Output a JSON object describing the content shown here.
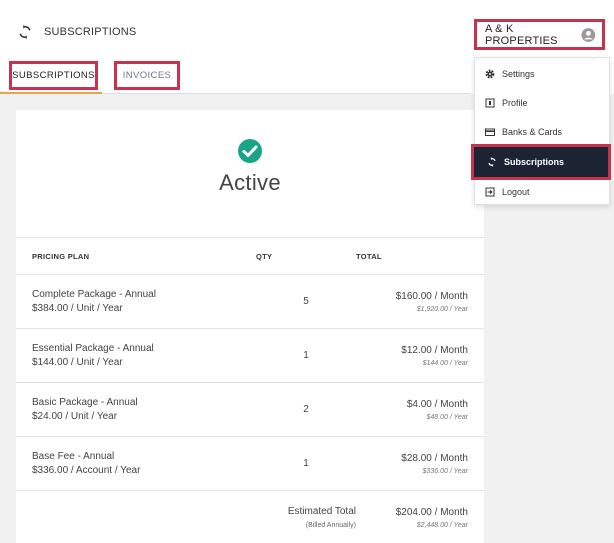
{
  "header": {
    "title": "SUBSCRIPTIONS",
    "account_name": "A & K PROPERTIES"
  },
  "tabs": [
    {
      "label": "SUBSCRIPTIONS",
      "active": true
    },
    {
      "label": "INVOICES",
      "active": false
    }
  ],
  "status": {
    "text": "Active",
    "color": "#1aa386"
  },
  "table": {
    "headers": {
      "plan": "PRICING PLAN",
      "qty": "QTY",
      "total": "TOTAL"
    },
    "rows": [
      {
        "name": "Complete Package - Annual",
        "unit_price": "$384.00 / Unit / Year",
        "qty": "5",
        "monthly": "$160.00 / Month",
        "yearly": "$1,920.00 / Year"
      },
      {
        "name": "Essential Package - Annual",
        "unit_price": "$144.00 / Unit / Year",
        "qty": "1",
        "monthly": "$12.00 / Month",
        "yearly": "$144.00 / Year"
      },
      {
        "name": "Basic Package - Annual",
        "unit_price": "$24.00 / Unit / Year",
        "qty": "2",
        "monthly": "$4.00 / Month",
        "yearly": "$48.00 / Year"
      },
      {
        "name": "Base Fee - Annual",
        "unit_price": "$336.00 / Account / Year",
        "qty": "1",
        "monthly": "$28.00 / Month",
        "yearly": "$336.00 / Year"
      }
    ],
    "estimate": {
      "label": "Estimated Total",
      "note": "(Billed Annually)",
      "monthly": "$204.00 / Month",
      "yearly": "$2,448.00 / Year"
    }
  },
  "menu": {
    "items": [
      {
        "label": "Settings",
        "icon": "gear-icon"
      },
      {
        "label": "Profile",
        "icon": "profile-icon"
      },
      {
        "label": "Banks & Cards",
        "icon": "card-icon"
      },
      {
        "label": "Subscriptions",
        "icon": "sync-icon",
        "active": true
      },
      {
        "label": "Logout",
        "icon": "logout-icon"
      }
    ]
  },
  "colors": {
    "highlight": "#c7334f",
    "tab_underline": "#e8a34e",
    "menu_active_bg": "#1c2333"
  }
}
